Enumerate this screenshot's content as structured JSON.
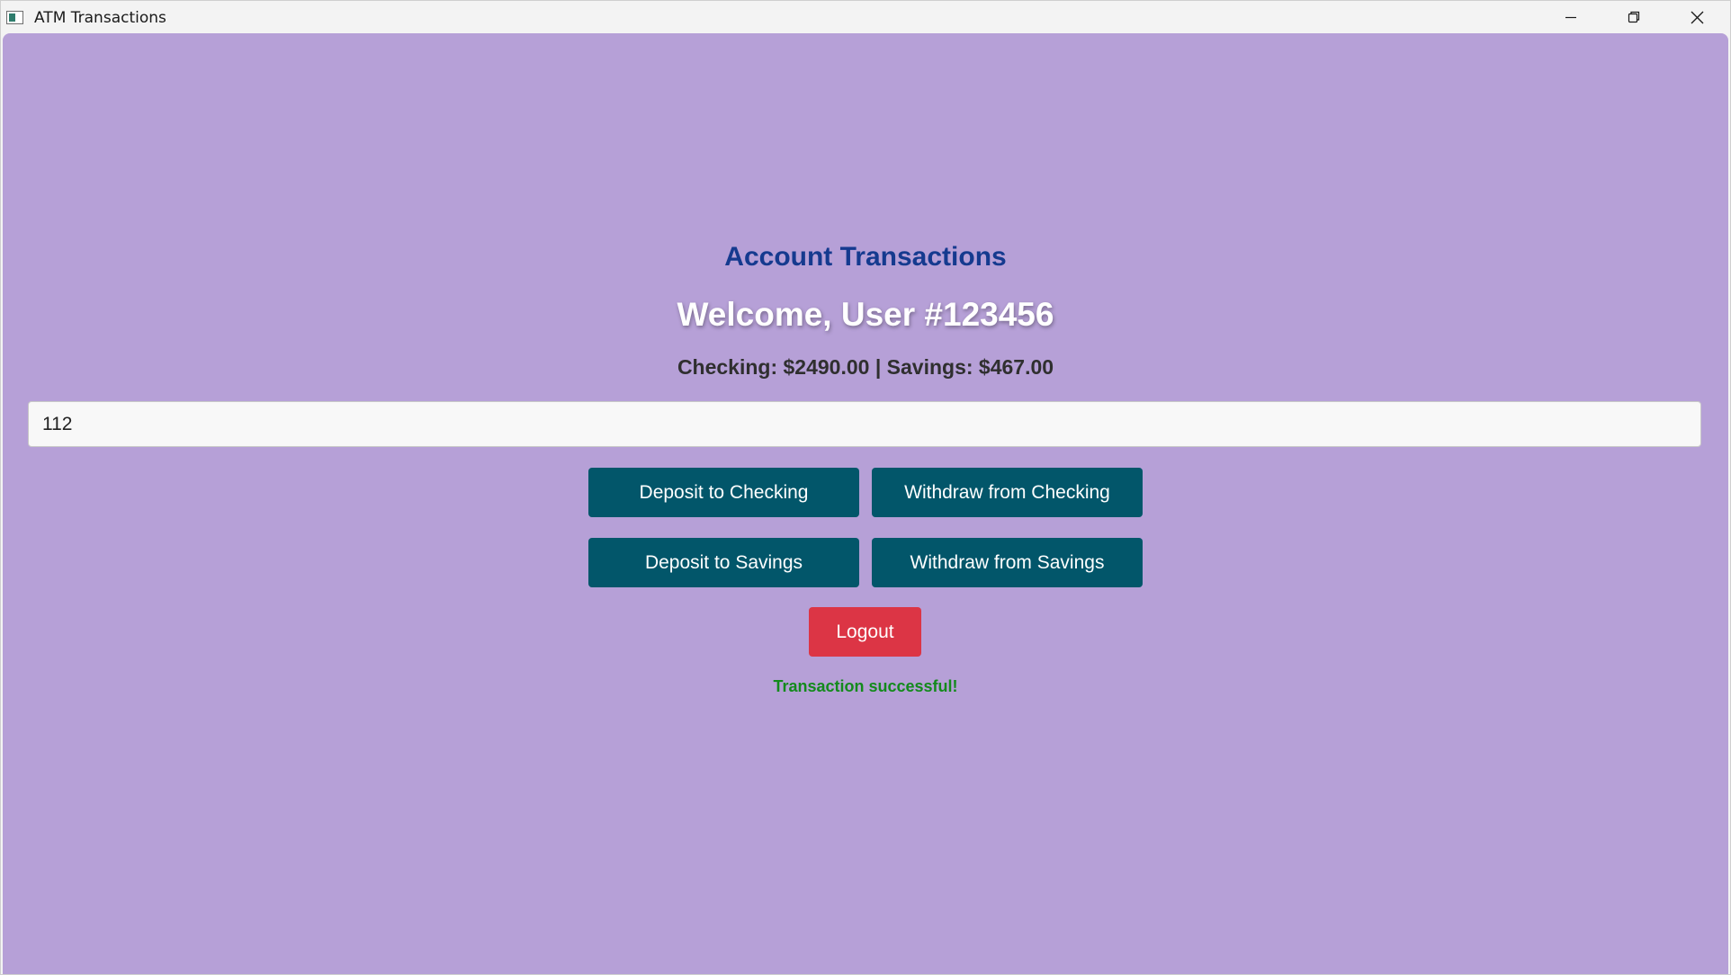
{
  "window": {
    "title": "ATM Transactions",
    "icons": {
      "app": "app-window-icon",
      "minimize": "minimize-icon",
      "maximize": "restore-icon",
      "close": "close-icon"
    }
  },
  "colors": {
    "background": "#b6a0d7",
    "title": "#153a8f",
    "welcome": "#ffffff",
    "button": "#02566a",
    "logout": "#dc3545",
    "success": "#138a1c"
  },
  "main": {
    "title": "Account Transactions",
    "welcome": "Welcome, User #123456",
    "balances": "Checking: $2490.00 | Savings: $467.00",
    "amount_input": {
      "value": "112"
    },
    "buttons": {
      "deposit_checking": "Deposit to Checking",
      "withdraw_checking": "Withdraw from Checking",
      "deposit_savings": "Deposit to Savings",
      "withdraw_savings": "Withdraw from Savings",
      "logout": "Logout"
    },
    "status_message": "Transaction successful!"
  }
}
